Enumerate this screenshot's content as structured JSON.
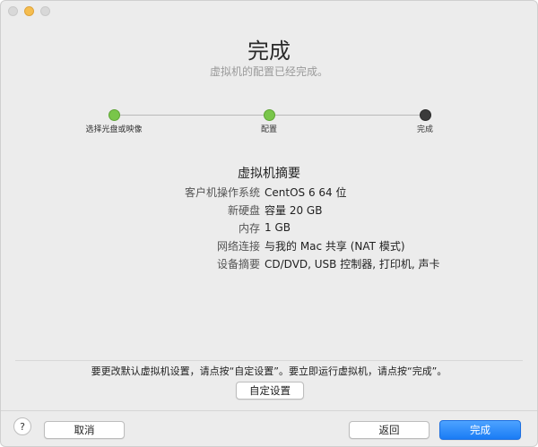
{
  "header": {
    "title": "完成",
    "subtitle": "虚拟机的配置已经完成。"
  },
  "stepper": {
    "steps": [
      {
        "label": "选择光盘或映像",
        "state": "done"
      },
      {
        "label": "配置",
        "state": "done"
      },
      {
        "label": "完成",
        "state": "current"
      }
    ]
  },
  "summary": {
    "title": "虚拟机摘要",
    "rows": [
      {
        "key": "客户机操作系统",
        "value": "CentOS 6 64 位"
      },
      {
        "key": "新硬盘",
        "value": "容量 20 GB"
      },
      {
        "key": "内存",
        "value": "1 GB"
      },
      {
        "key": "网络连接",
        "value": "与我的 Mac 共享 (NAT 模式)"
      },
      {
        "key": "设备摘要",
        "value": "CD/DVD, USB 控制器, 打印机, 声卡"
      }
    ]
  },
  "footer": {
    "hint": "要更改默认虚拟机设置，请点按“自定设置”。要立即运行虚拟机，请点按“完成”。",
    "custom_label": "自定设置",
    "help_label": "?",
    "cancel_label": "取消",
    "back_label": "返回",
    "finish_label": "完成"
  },
  "colors": {
    "accent": "#1a7cf5",
    "step_done": "#79c64a",
    "step_current": "#3b3b3b"
  }
}
